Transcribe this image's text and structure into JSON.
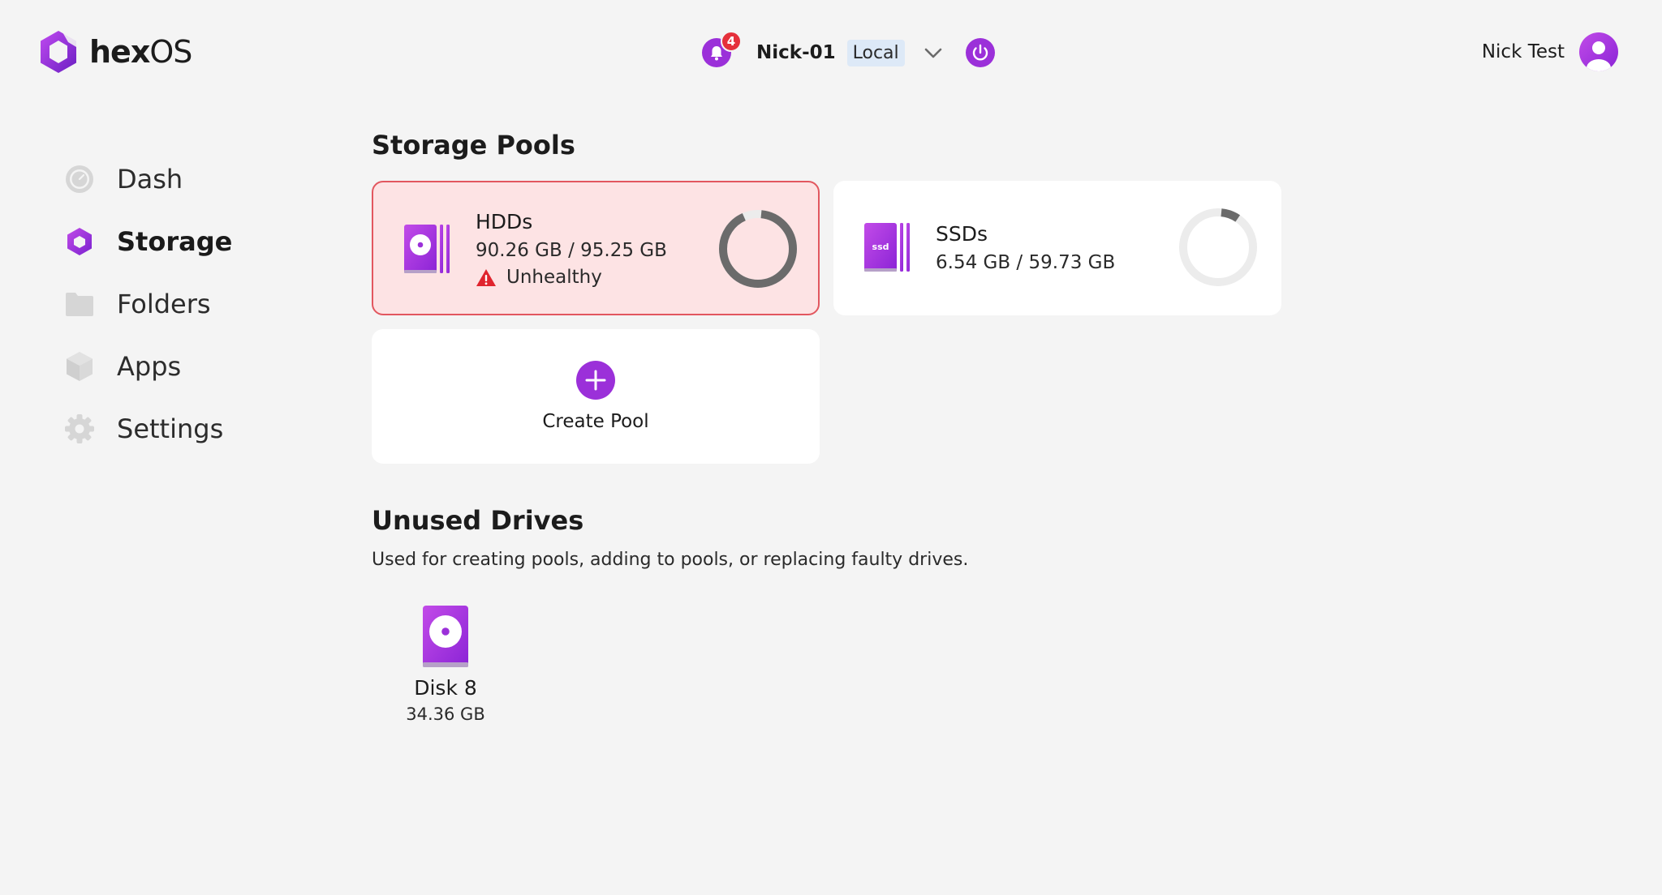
{
  "brand": {
    "name_bold": "hex",
    "name_light": "OS",
    "color": "#8a2be2"
  },
  "header": {
    "notification_count": "4",
    "server_name": "Nick-01",
    "server_tag": "Local",
    "user_name": "Nick Test"
  },
  "sidebar": {
    "items": [
      {
        "label": "Dash",
        "icon": "dashboard-gauge-icon",
        "active": false
      },
      {
        "label": "Storage",
        "icon": "hexagon-icon",
        "active": true
      },
      {
        "label": "Folders",
        "icon": "folder-icon",
        "active": false
      },
      {
        "label": "Apps",
        "icon": "cube-icon",
        "active": false
      },
      {
        "label": "Settings",
        "icon": "gear-icon",
        "active": false
      }
    ]
  },
  "storage_pools": {
    "title": "Storage Pools",
    "pools": [
      {
        "name": "HDDs",
        "usage": "90.26 GB / 95.25 GB",
        "status": "Unhealthy",
        "used_fraction": 0.948,
        "icon": "hdd-pool-icon"
      },
      {
        "name": "SSDs",
        "usage": "6.54 GB / 59.73 GB",
        "used_fraction": 0.11,
        "icon": "ssd-pool-icon",
        "icon_text": "ssd"
      }
    ],
    "create_label": "Create Pool"
  },
  "unused_drives": {
    "title": "Unused Drives",
    "description": "Used for creating pools, adding to pools, or replacing faulty drives.",
    "drives": [
      {
        "name": "Disk 8",
        "size": "34.36 GB"
      }
    ]
  },
  "colors": {
    "accent": "#9b30d9",
    "danger": "#e5303b",
    "unhealthy_bg": "#fde3e4",
    "donut_used": "#6b6b6b",
    "donut_free": "#ececec"
  }
}
